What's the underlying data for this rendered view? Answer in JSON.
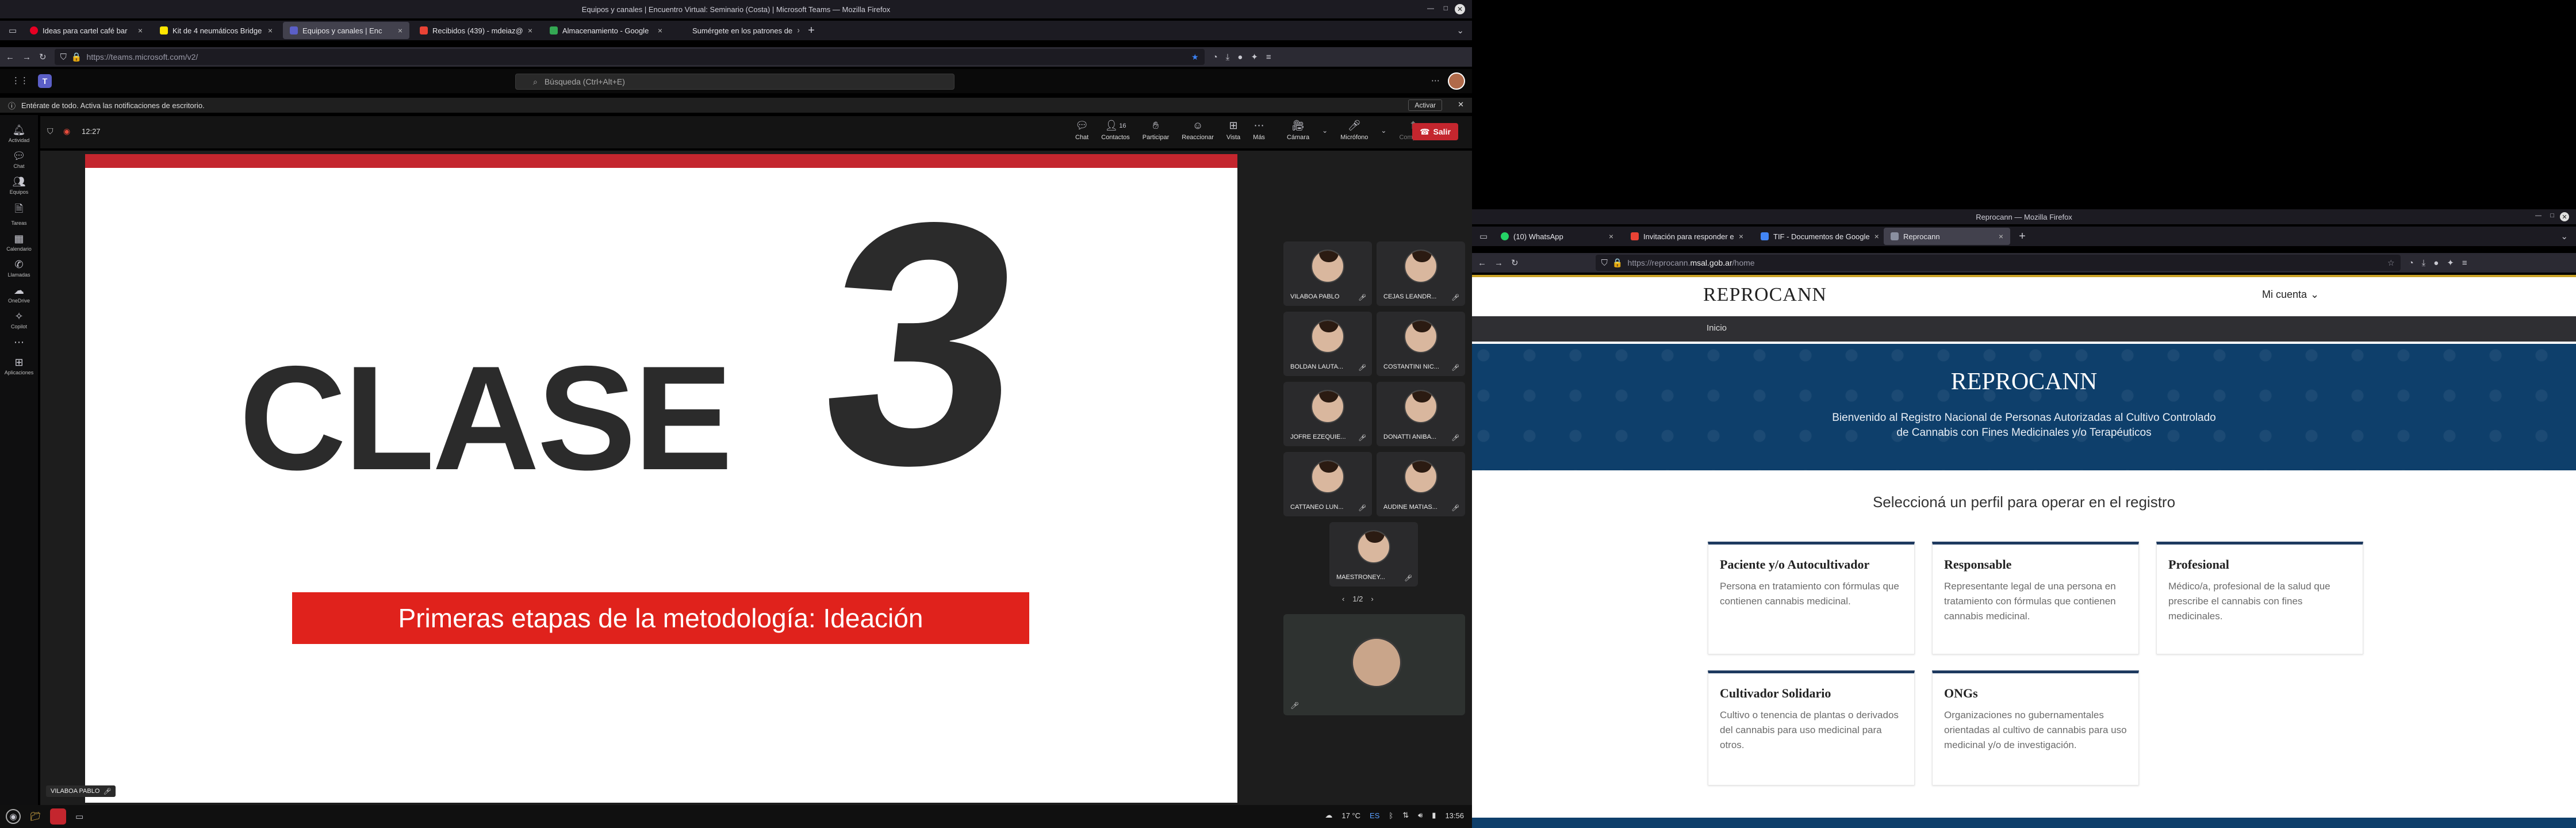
{
  "left_window": {
    "title": "Equipos y canales | Encuentro Virtual: Seminario (Costa) | Microsoft Teams — Mozilla Firefox",
    "tabs": [
      {
        "label": "Ideas para cartel café bar",
        "active": false
      },
      {
        "label": "Kit de 4 neumáticos Bridge",
        "active": false
      },
      {
        "label": "Equipos y canales | Enc",
        "active": true
      },
      {
        "label": "Recibidos (439) - mdeiaz@",
        "active": false
      },
      {
        "label": "Almacenamiento - Google",
        "active": false
      },
      {
        "label": "Sumérgete en los patrones de",
        "active": false
      }
    ],
    "url": "https://teams.microsoft.com/v2/",
    "search_placeholder": "Búsqueda (Ctrl+Alt+E)",
    "notification": {
      "text": "Entérate de todo. Activa las notificaciones de escritorio.",
      "button": "Activar"
    },
    "meeting_timer": "12:27",
    "rail": [
      "Actividad",
      "Chat",
      "Equipos",
      "Tareas",
      "Calendario",
      "Llamadas",
      "OneDrive",
      "Copilot",
      "",
      "Aplicaciones"
    ],
    "controls": [
      {
        "label": "Chat",
        "icon": "chat-icon"
      },
      {
        "label": "Contactos",
        "icon": "people-icon",
        "count": "16"
      },
      {
        "label": "Participar",
        "icon": "hand-icon"
      },
      {
        "label": "Reaccionar",
        "icon": "smile-icon"
      },
      {
        "label": "Vista",
        "icon": "grid-icon"
      },
      {
        "label": "Más",
        "icon": "more-icon"
      },
      {
        "label": "Cámara",
        "icon": "camera-icon"
      },
      {
        "label": "Micrófono",
        "icon": "mic-icon"
      },
      {
        "label": "Compartir",
        "icon": "share-icon"
      }
    ],
    "leave_button": "Salir",
    "slide": {
      "word": "CLASE",
      "number": "3",
      "subtitle": "Primeras etapas de la metodología: Ideación"
    },
    "participants": [
      "VILABOA PABLO",
      "CEJAS LEANDR...",
      "BOLDAN LAUTA...",
      "COSTANTINI NIC...",
      "JOFRE EZEQUIE...",
      "DONATTI ANIBA...",
      "CATTANEO LUN...",
      "AUDINE MATIAS...",
      "MAESTRONEY..."
    ],
    "pagination": "1/2",
    "speaker_tooltip": "VILABOA PABLO"
  },
  "taskbar": {
    "weather": "17 °C",
    "language": "ES",
    "time": "13:56"
  },
  "right_window": {
    "title": "Reprocann — Mozilla Firefox",
    "tabs": [
      {
        "label": "(10) WhatsApp",
        "active": false
      },
      {
        "label": "Invitación para responder e",
        "active": false
      },
      {
        "label": "TIF - Documentos de Google",
        "active": false
      },
      {
        "label": "Reprocann",
        "active": true
      }
    ],
    "url_prefix": "https://reprocann.",
    "url_domain": "msal.gob.ar",
    "url_suffix": "/home",
    "site": {
      "logo": "REPROCANN",
      "account": "Mi cuenta",
      "nav_home": "Inicio",
      "hero_title": "REPROCANN",
      "hero_line1": "Bienvenido al Registro Nacional de Personas Autorizadas al Cultivo Controlado",
      "hero_line2": "de Cannabis con Fines Medicinales y/o Terapéuticos",
      "profiles_heading": "Seleccioná un perfil para operar en el registro",
      "cards": [
        {
          "title": "Paciente y/o Autocultivador",
          "desc": "Persona en tratamiento con fórmulas que contienen cannabis medicinal."
        },
        {
          "title": "Responsable",
          "desc": "Representante legal de una persona en tratamiento con fórmulas que contienen cannabis medicinal."
        },
        {
          "title": "Profesional",
          "desc": "Médico/a, profesional de la salud que prescribe el cannabis con fines medicinales."
        },
        {
          "title": "Cultivador Solidario",
          "desc": "Cultivo o tenencia de plantas o derivados del cannabis para uso medicinal para otros."
        },
        {
          "title": "ONGs",
          "desc": "Organizaciones no gubernamentales orientadas al cultivo de cannabis para uso medicinal y/o de investigación."
        }
      ]
    }
  },
  "colors": {
    "teams_red": "#c4262e",
    "gov_blue": "#1e3a5f",
    "firefox_dark": "#1c1b22"
  }
}
